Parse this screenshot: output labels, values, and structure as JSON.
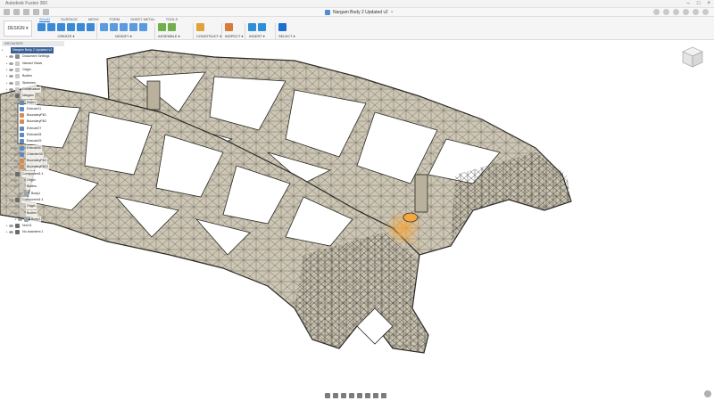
{
  "window": {
    "title": "Autodesk Fusion 360"
  },
  "document": {
    "tab_title": "Nargam Body 2 Updated v2",
    "close_glyph": "×"
  },
  "workspace": {
    "label": "DESIGN ▾"
  },
  "ribbon": {
    "tabs": [
      {
        "label": "SOLID",
        "active": true
      },
      {
        "label": "SURFACE",
        "active": false
      },
      {
        "label": "MESH",
        "active": false
      },
      {
        "label": "FORM",
        "active": false
      },
      {
        "label": "SHEET METAL",
        "active": false
      },
      {
        "label": "TOOLS",
        "active": false
      }
    ],
    "groups": [
      {
        "label": "CREATE ▾",
        "icons": [
          "sketch-icon",
          "extrude-icon",
          "revolve-icon",
          "sweep-icon",
          "box-icon",
          "pattern-icon"
        ]
      },
      {
        "label": "MODIFY ▾",
        "icons": [
          "press-pull-icon",
          "fillet-icon",
          "chamfer-icon",
          "shell-icon",
          "move-icon"
        ]
      },
      {
        "label": "ASSEMBLE ▾",
        "icons": [
          "new-component-icon",
          "joint-icon"
        ]
      },
      {
        "label": "CONSTRUCT ▾",
        "icons": [
          "offset-plane-icon"
        ]
      },
      {
        "label": "INSPECT ▾",
        "icons": [
          "measure-icon"
        ]
      },
      {
        "label": "INSERT ▾",
        "icons": [
          "insert-icon",
          "decal-icon"
        ]
      },
      {
        "label": "SELECT ▾",
        "icons": [
          "select-icon"
        ]
      }
    ]
  },
  "browser": {
    "header": "BROWSER",
    "items": [
      {
        "label": "Nargam Body 2 Updated v2",
        "depth": 0,
        "icon": "document-icon",
        "root": true
      },
      {
        "label": "Document Settings",
        "depth": 1,
        "icon": "gear-icon"
      },
      {
        "label": "Named Views",
        "depth": 1,
        "icon": "folder-icon"
      },
      {
        "label": "Origin",
        "depth": 1,
        "icon": "folder-icon"
      },
      {
        "label": "Bodies",
        "depth": 1,
        "icon": "folder-icon"
      },
      {
        "label": "Sketches",
        "depth": 1,
        "icon": "folder-icon"
      },
      {
        "label": "Construction",
        "depth": 1,
        "icon": "folder-icon"
      },
      {
        "label": "Nargam",
        "depth": 1,
        "icon": "component-icon"
      },
      {
        "label": "Plate1",
        "depth": 2,
        "icon": "sketch-icon"
      },
      {
        "label": "Extrude11",
        "depth": 2,
        "icon": "extrude-icon"
      },
      {
        "label": "BoundaryFill1",
        "depth": 2,
        "icon": "boundary-icon"
      },
      {
        "label": "BoundaryFill2",
        "depth": 2,
        "icon": "boundary-icon"
      },
      {
        "label": "Extrude27",
        "depth": 2,
        "icon": "extrude-icon"
      },
      {
        "label": "Extrude28",
        "depth": 2,
        "icon": "extrude-icon"
      },
      {
        "label": "Extrude29",
        "depth": 2,
        "icon": "extrude-icon"
      },
      {
        "label": "Extrude30",
        "depth": 2,
        "icon": "extrude-icon"
      },
      {
        "label": "Chamfer35",
        "depth": 2,
        "icon": "chamfer-icon"
      },
      {
        "label": "BoundaryFill3",
        "depth": 2,
        "icon": "boundary-icon"
      },
      {
        "label": "BoundaryFill22",
        "depth": 2,
        "icon": "boundary-icon"
      },
      {
        "label": "Component1:1",
        "depth": 1,
        "icon": "component-icon"
      },
      {
        "label": "Origin",
        "depth": 2,
        "icon": "folder-icon"
      },
      {
        "label": "Bodies",
        "depth": 2,
        "icon": "folder-icon"
      },
      {
        "label": "Body1",
        "depth": 3,
        "icon": "body-icon"
      },
      {
        "label": "Component1:1",
        "depth": 1,
        "icon": "component-icon"
      },
      {
        "label": "Origin",
        "depth": 2,
        "icon": "folder-icon"
      },
      {
        "label": "Bodies",
        "depth": 2,
        "icon": "folder-icon"
      },
      {
        "label": "Body1",
        "depth": 3,
        "icon": "body-icon"
      },
      {
        "label": "Nut:01",
        "depth": 1,
        "icon": "component-icon"
      },
      {
        "label": "No chamfers:1",
        "depth": 1,
        "icon": "component-icon"
      }
    ]
  },
  "colors": {
    "lattice_fill": "#cdc6b4",
    "lattice_shadow": "#8d8775",
    "mesh_line": "#2a2924",
    "highlight": "#f4a640",
    "accent": "#1a6fd1"
  }
}
